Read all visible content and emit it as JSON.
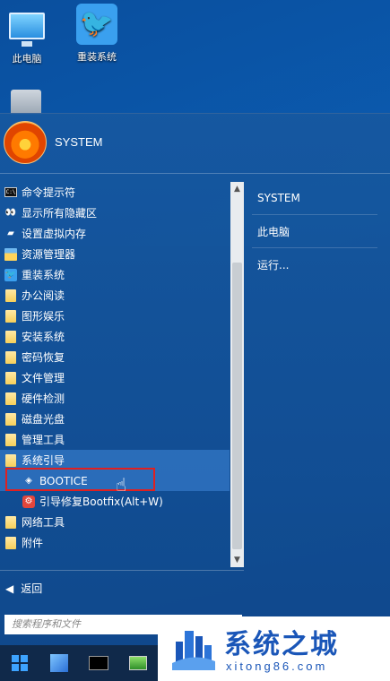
{
  "desktop": {
    "icons": [
      {
        "label": "此电脑",
        "icon": "computer-icon"
      },
      {
        "label": "重装系统",
        "icon": "twitter-bird-icon"
      }
    ]
  },
  "start_menu": {
    "user_name": "SYSTEM",
    "items": [
      {
        "label": "命令提示符",
        "icon": "cmd-icon"
      },
      {
        "label": "显示所有隐藏区",
        "icon": "eye-icon"
      },
      {
        "label": "设置虚拟内存",
        "icon": "memory-icon"
      },
      {
        "label": "资源管理器",
        "icon": "explorer-icon"
      },
      {
        "label": "重装系统",
        "icon": "twitter-bird-icon"
      },
      {
        "label": "办公阅读",
        "icon": "folder-icon"
      },
      {
        "label": "图形娱乐",
        "icon": "folder-icon"
      },
      {
        "label": "安装系统",
        "icon": "folder-icon"
      },
      {
        "label": "密码恢复",
        "icon": "folder-icon"
      },
      {
        "label": "文件管理",
        "icon": "folder-icon"
      },
      {
        "label": "硬件检测",
        "icon": "folder-icon"
      },
      {
        "label": "磁盘光盘",
        "icon": "folder-icon"
      },
      {
        "label": "管理工具",
        "icon": "folder-icon"
      },
      {
        "label": "系统引导",
        "icon": "folder-icon"
      },
      {
        "label": "BOOTICE",
        "icon": "bootice-icon"
      },
      {
        "label": "引导修复Bootfix(Alt+W)",
        "icon": "bootfix-icon"
      },
      {
        "label": "网络工具",
        "icon": "folder-icon"
      },
      {
        "label": "附件",
        "icon": "folder-icon"
      }
    ],
    "back_label": "返回",
    "search_placeholder": "搜索程序和文件",
    "right_items": [
      "SYSTEM",
      "此电脑",
      "运行..."
    ]
  },
  "watermark": {
    "title": "系统之城",
    "url": "xitong86.com"
  },
  "colors": {
    "accent": "#1a56b8",
    "highlight_box": "#e02020",
    "menu_bg": "#1658a0"
  }
}
